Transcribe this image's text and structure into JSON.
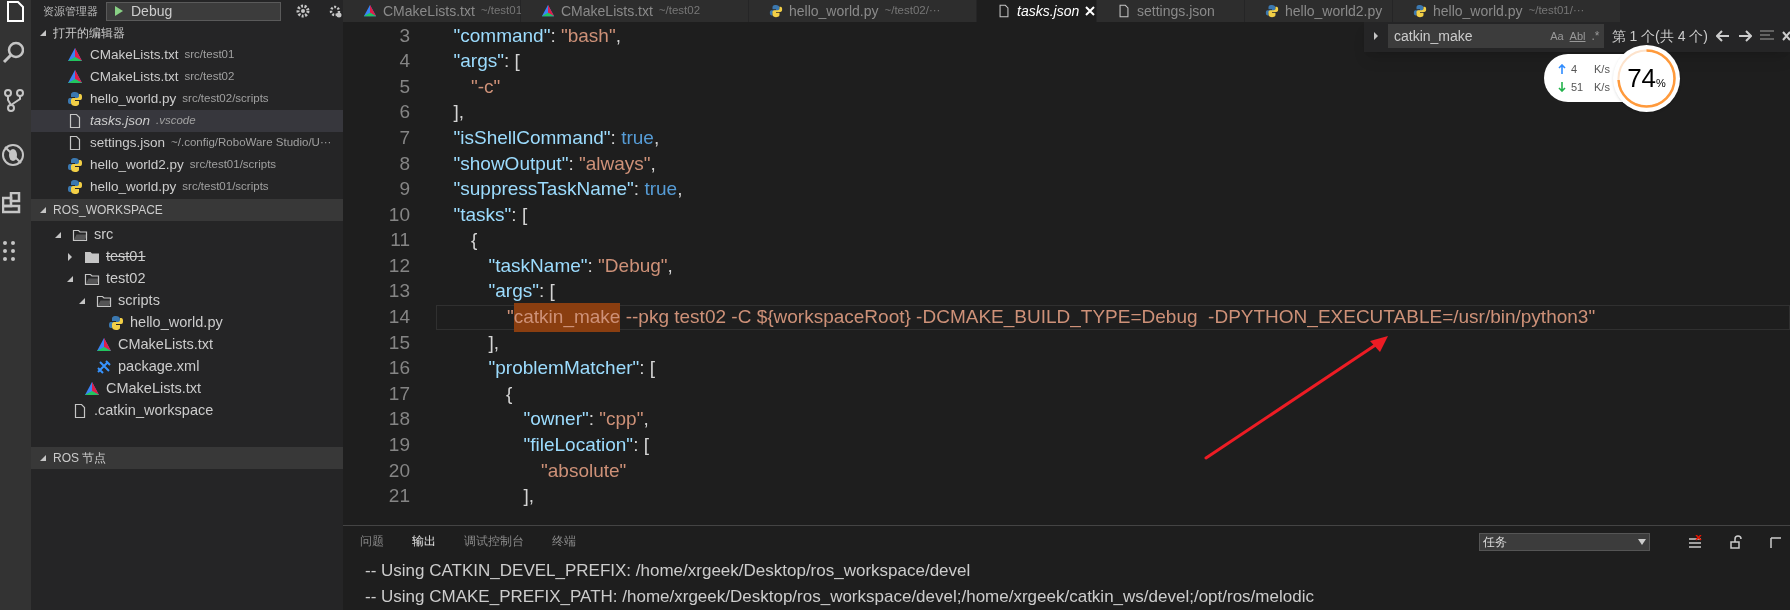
{
  "sidebar": {
    "title": "资源管理器",
    "config_dropdown": "Debug",
    "open_editors": {
      "title": "打开的编辑器",
      "expanded": true,
      "items": [
        {
          "kind": "cmake",
          "name": "CMakeLists.txt",
          "path": "src/test01",
          "selected": false,
          "preview": false
        },
        {
          "kind": "cmake",
          "name": "CMakeLists.txt",
          "path": "src/test02",
          "selected": false,
          "preview": false
        },
        {
          "kind": "python",
          "name": "hello_world.py",
          "path": "src/test02/scripts",
          "selected": false,
          "preview": false
        },
        {
          "kind": "file",
          "name": "tasks.json",
          "path": ".vscode",
          "selected": true,
          "preview": true
        },
        {
          "kind": "file",
          "name": "settings.json",
          "path": "~/.config/RoboWare Studio/U···",
          "selected": false,
          "preview": false
        },
        {
          "kind": "python",
          "name": "hello_world2.py",
          "path": "src/test01/scripts",
          "selected": false,
          "preview": false
        },
        {
          "kind": "python",
          "name": "hello_world.py",
          "path": "src/test01/scripts",
          "selected": false,
          "preview": false
        }
      ]
    },
    "workspace": {
      "title": "ROS_WORKSPACE",
      "expanded": true,
      "tree": [
        {
          "kind": "folder",
          "name": "src",
          "expanded": true,
          "children": [
            {
              "kind": "folder",
              "name": "test01",
              "expanded": false,
              "struck": true
            },
            {
              "kind": "folder",
              "name": "test02",
              "expanded": true,
              "children": [
                {
                  "kind": "folder",
                  "name": "scripts",
                  "expanded": true,
                  "children": [
                    {
                      "kind": "python",
                      "name": "hello_world.py"
                    }
                  ]
                },
                {
                  "kind": "cmake",
                  "name": "CMakeLists.txt"
                },
                {
                  "kind": "package",
                  "name": "package.xml"
                }
              ]
            },
            {
              "kind": "cmake",
              "name": "CMakeLists.txt"
            }
          ]
        },
        {
          "kind": "file",
          "name": ".catkin_workspace"
        }
      ]
    },
    "nodes": {
      "title": "ROS 节点",
      "expanded": true
    }
  },
  "tabs": [
    {
      "name": "CMakeLists.txt",
      "path": "~/test01",
      "kind": "cmake",
      "selected": false
    },
    {
      "name": "CMakeLists.txt",
      "path": "~/test02",
      "kind": "cmake",
      "selected": false
    },
    {
      "name": "hello_world.py",
      "path": "~/test02/···",
      "kind": "python",
      "selected": false
    },
    {
      "name": "tasks.json",
      "kind": "file",
      "selected": true
    },
    {
      "name": "settings.json",
      "kind": "file",
      "selected": false
    },
    {
      "name": "hello_world2.py",
      "kind": "python",
      "selected": false
    },
    {
      "name": "hello_world.py",
      "path": "~/test01/···",
      "kind": "python",
      "selected": false
    }
  ],
  "editor": {
    "lines": [
      {
        "number": "3",
        "tokens": [
          {
            "kind": "key",
            "text": "  \"command\""
          },
          {
            "kind": "punct",
            "text": ": "
          },
          {
            "kind": "string",
            "text": "\"bash\""
          },
          {
            "kind": "punct",
            "text": ","
          }
        ]
      },
      {
        "number": "4",
        "tokens": [
          {
            "kind": "key",
            "text": "  \"args\""
          },
          {
            "kind": "punct",
            "text": ": ["
          }
        ]
      },
      {
        "number": "5",
        "tokens": [
          {
            "kind": "string",
            "text": "    \"-c\""
          }
        ]
      },
      {
        "number": "6",
        "tokens": [
          {
            "kind": "punct",
            "text": "  ],"
          }
        ]
      },
      {
        "number": "7",
        "tokens": [
          {
            "kind": "key",
            "text": "  \"isShellCommand\""
          },
          {
            "kind": "punct",
            "text": ": "
          },
          {
            "kind": "keyword",
            "text": "true"
          },
          {
            "kind": "punct",
            "text": ","
          }
        ]
      },
      {
        "number": "8",
        "tokens": [
          {
            "kind": "key",
            "text": "  \"showOutput\""
          },
          {
            "kind": "punct",
            "text": ": "
          },
          {
            "kind": "string",
            "text": "\"always\""
          },
          {
            "kind": "punct",
            "text": ","
          }
        ]
      },
      {
        "number": "9",
        "tokens": [
          {
            "kind": "key",
            "text": "  \"suppressTaskName\""
          },
          {
            "kind": "punct",
            "text": ": "
          },
          {
            "kind": "keyword",
            "text": "true"
          },
          {
            "kind": "punct",
            "text": ","
          }
        ]
      },
      {
        "number": "10",
        "tokens": [
          {
            "kind": "key",
            "text": "  \"tasks\""
          },
          {
            "kind": "punct",
            "text": ": ["
          }
        ]
      },
      {
        "number": "11",
        "tokens": [
          {
            "kind": "punct",
            "text": "    {"
          }
        ]
      },
      {
        "number": "12",
        "tokens": [
          {
            "kind": "key",
            "text": "      \"taskName\""
          },
          {
            "kind": "punct",
            "text": ": "
          },
          {
            "kind": "string",
            "text": "\"Debug\""
          },
          {
            "kind": "punct",
            "text": ","
          }
        ]
      },
      {
        "number": "13",
        "tokens": [
          {
            "kind": "key",
            "text": "      \"args\""
          },
          {
            "kind": "punct",
            "text": ": ["
          }
        ]
      },
      {
        "number": "14",
        "current": true,
        "tokens": [
          {
            "kind": "string",
            "text": "        \""
          },
          {
            "kind": "match",
            "text": "catkin_make"
          },
          {
            "kind": "string",
            "text": " --pkg test02 -C ${workspaceRoot} -DCMAKE_BUILD_TYPE=Debug  -DPYTHON_EXECUTABLE=/usr/bin/python3\""
          }
        ]
      },
      {
        "number": "15",
        "tokens": [
          {
            "kind": "punct",
            "text": "      ],"
          }
        ]
      },
      {
        "number": "16",
        "tokens": [
          {
            "kind": "key",
            "text": "      \"problemMatcher\""
          },
          {
            "kind": "punct",
            "text": ": ["
          }
        ]
      },
      {
        "number": "17",
        "tokens": [
          {
            "kind": "punct",
            "text": "        {"
          }
        ]
      },
      {
        "number": "18",
        "tokens": [
          {
            "kind": "key",
            "text": "          \"owner\""
          },
          {
            "kind": "punct",
            "text": ": "
          },
          {
            "kind": "string",
            "text": "\"cpp\""
          },
          {
            "kind": "punct",
            "text": ","
          }
        ]
      },
      {
        "number": "19",
        "tokens": [
          {
            "kind": "key",
            "text": "          \"fileLocation\""
          },
          {
            "kind": "punct",
            "text": ": ["
          }
        ]
      },
      {
        "number": "20",
        "tokens": [
          {
            "kind": "string",
            "text": "            \"absolute\""
          }
        ]
      },
      {
        "number": "21",
        "tokens": [
          {
            "kind": "punct",
            "text": "          ],"
          }
        ]
      }
    ]
  },
  "find_widget": {
    "query": "catkin_make",
    "match_case": "Aa",
    "whole_word": "Abl",
    "regex": ".*",
    "result": "第 1 个(共 4 个)"
  },
  "net_monitor": {
    "upload": "4",
    "upload_unit": "K/s",
    "download": "51",
    "download_unit": "K/s",
    "usage": "74",
    "usage_unit": "%"
  },
  "panel": {
    "tabs": [
      {
        "label": "问题",
        "selected": false
      },
      {
        "label": "输出",
        "selected": true
      },
      {
        "label": "调试控制台",
        "selected": false
      },
      {
        "label": "终端",
        "selected": false
      }
    ],
    "channel": "任务",
    "output": [
      "-- Using CATKIN_DEVEL_PREFIX: /home/xrgeek/Desktop/ros_workspace/devel",
      "-- Using CMAKE_PREFIX_PATH: /home/xrgeek/Desktop/ros_workspace/devel;/home/xrgeek/catkin_ws/devel;/opt/ros/melodic"
    ]
  }
}
